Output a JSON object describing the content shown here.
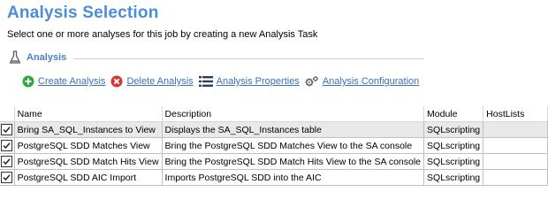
{
  "page": {
    "title": "Analysis Selection",
    "subtitle": "Select one or more analyses for this job by creating a new Analysis Task"
  },
  "group": {
    "label": "Analysis",
    "icon": "flask-icon"
  },
  "toolbar": {
    "create_label": "Create Analysis",
    "delete_label": "Delete Analysis",
    "properties_label": "Analysis Properties",
    "configuration_label": "Analysis Configuration",
    "colors": {
      "create": "#2eaa3c",
      "delete": "#d9342b",
      "link": "#3a6fbd"
    }
  },
  "table": {
    "columns": [
      "Name",
      "Description",
      "Module",
      "HostLists"
    ],
    "rows": [
      {
        "checked": true,
        "name": "Bring SA_SQL_Instances to View",
        "description": "Displays the SA_SQL_Instances table",
        "module": "SQLscripting",
        "hostlists": ""
      },
      {
        "checked": true,
        "name": "PostgreSQL SDD Matches View",
        "description": "Bring the PostgreSQL SDD Matches View to the SA console",
        "module": "SQLscripting",
        "hostlists": ""
      },
      {
        "checked": true,
        "name": "PostgreSQL SDD Match Hits View",
        "description": "Bring the PostgreSQL SDD Match Hits View to the SA console",
        "module": "SQLscripting",
        "hostlists": ""
      },
      {
        "checked": true,
        "name": "PostgreSQL SDD AIC Import",
        "description": "Imports PostgreSQL SDD into the AIC",
        "module": "SQLscripting",
        "hostlists": ""
      }
    ]
  },
  "theme": {
    "title_color": "#4a8ed8",
    "group_color": "#4a7fc0",
    "selected_row": "#e9e9e9"
  }
}
